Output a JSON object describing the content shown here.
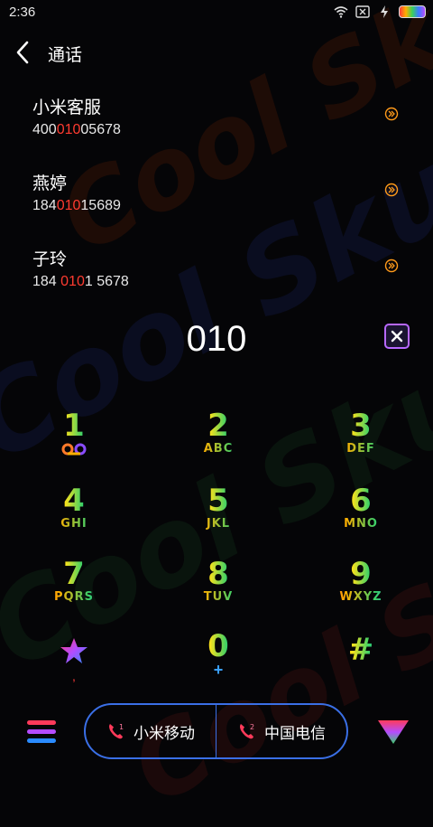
{
  "status": {
    "time": "2:36"
  },
  "header": {
    "title": "通话"
  },
  "contacts": [
    {
      "name": "小米客服",
      "num_pre": "400",
      "num_hl": "010",
      "num_post": "05678"
    },
    {
      "name": "燕婷",
      "num_pre": "184",
      "num_hl": "010",
      "num_post": "15689"
    },
    {
      "name": "子玲",
      "num_pre": "184 ",
      "num_hl": "010",
      "num_post": "1 5678"
    }
  ],
  "dialer": {
    "number": "010"
  },
  "keypad": [
    {
      "digit": "1",
      "letters": ""
    },
    {
      "digit": "2",
      "letters": "ABC"
    },
    {
      "digit": "3",
      "letters": "DEF"
    },
    {
      "digit": "4",
      "letters": "GHI"
    },
    {
      "digit": "5",
      "letters": "JKL"
    },
    {
      "digit": "6",
      "letters": "MNO"
    },
    {
      "digit": "7",
      "letters": "PQRS"
    },
    {
      "digit": "8",
      "letters": "TUV"
    },
    {
      "digit": "9",
      "letters": "WXYZ"
    },
    {
      "digit": "",
      "letters": ","
    },
    {
      "digit": "0",
      "letters": "+"
    },
    {
      "digit": "#",
      "letters": ""
    }
  ],
  "sims": [
    {
      "index": "1",
      "label": "小米移动"
    },
    {
      "index": "2",
      "label": "中国电信"
    }
  ],
  "colors": {
    "accent_red": "#ff3b30",
    "sim_border": "#3a6fe6",
    "clear_border": "#b768ff"
  }
}
